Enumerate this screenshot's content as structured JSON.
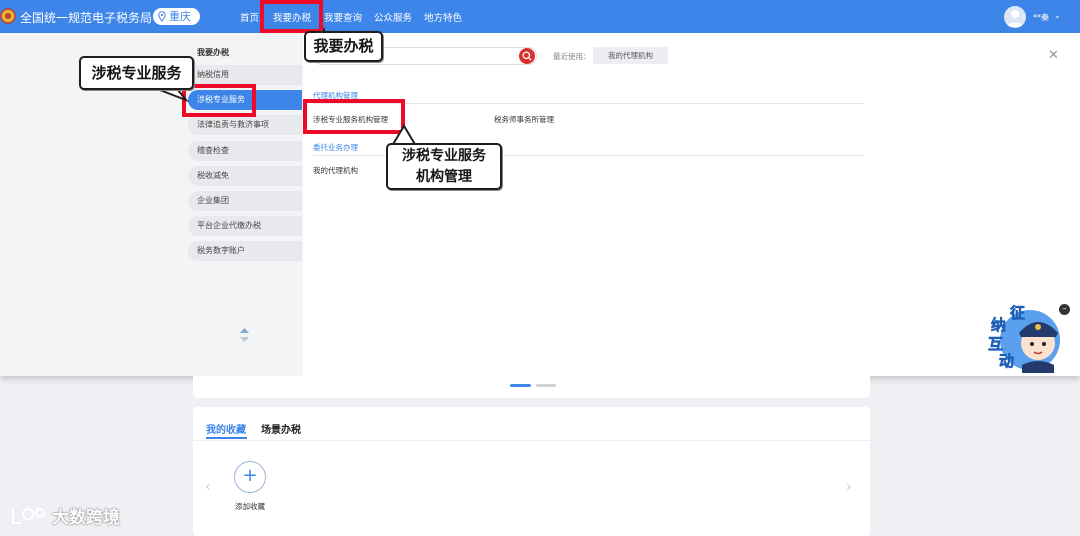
{
  "header": {
    "app_title": "全国统一规范电子税务局",
    "region": "重庆",
    "nav": [
      "首页",
      "我要办税",
      "我要查询",
      "公众服务",
      "地方特色"
    ],
    "user_name": "**秦",
    "caret": "⌄"
  },
  "sidebar": {
    "title": "我要办税",
    "items": [
      "纳税信用",
      "涉税专业服务",
      "法律追责与救济事项",
      "稽查检查",
      "税收减免",
      "企业集团",
      "平台企业代缴办税",
      "税务数字账户"
    ]
  },
  "search": {
    "placeholder": "",
    "recent_label": "最近使用：",
    "recent_item": "我的代理机构"
  },
  "content": {
    "section1_title": "代理机构管理",
    "section1_links": [
      "涉税专业服务机构管理",
      "税务师事务所管理"
    ],
    "section2_title": "委托业务办理",
    "section2_links": [
      "我的代理机构"
    ]
  },
  "callouts": {
    "nav": "我要办税",
    "sidebar": "涉税专业服务",
    "link_line1": "涉税专业服务",
    "link_line2": "机构管理"
  },
  "background": {
    "tabs": [
      "我的收藏",
      "场景办税"
    ],
    "add_label": "添加收藏",
    "add_symbol": "+"
  },
  "assistant": {
    "chars": [
      "征",
      "纳",
      "互",
      "动"
    ],
    "close": "–"
  },
  "watermark": "大数跨境",
  "colors": {
    "brand_blue": "#3d85e9",
    "highlight_red": "#ee0b2a",
    "search_red": "#d9312c"
  }
}
